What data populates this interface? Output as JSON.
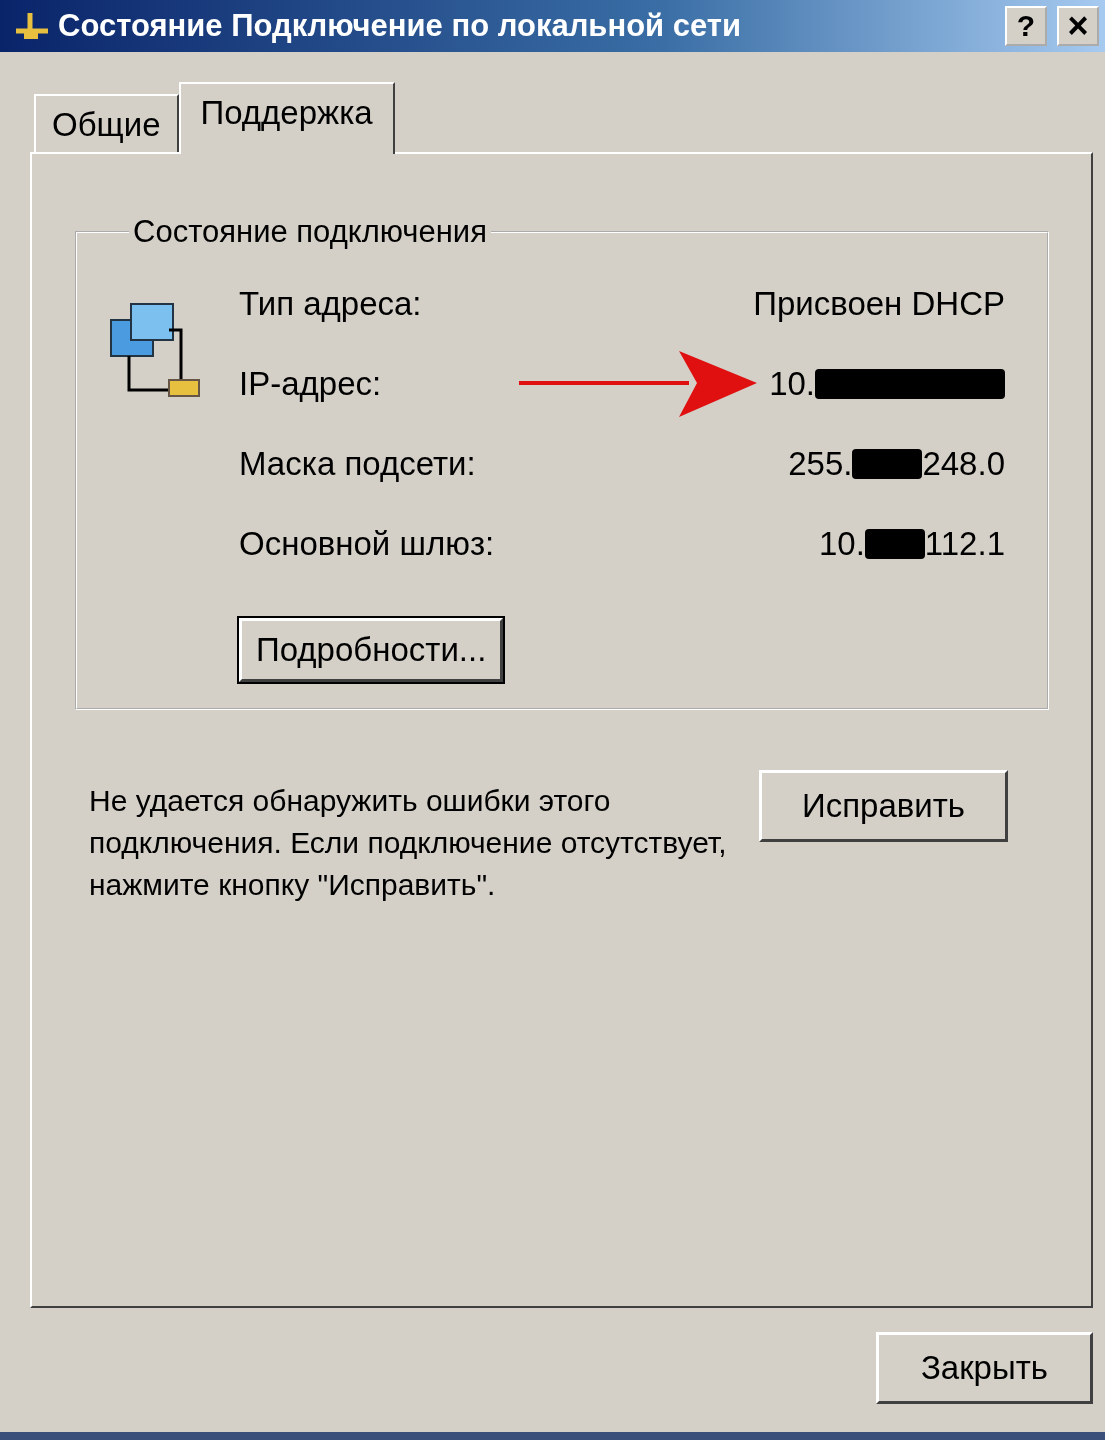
{
  "window": {
    "title": "Состояние Подключение по локальной сети",
    "buttons": [
      {
        "kind": "help",
        "label": "?"
      },
      {
        "kind": "close",
        "label": "×"
      }
    ]
  },
  "tabs": [
    {
      "label": "Общие",
      "selected": false
    },
    {
      "label": "Поддержка",
      "selected": true
    }
  ],
  "group": {
    "title": "Состояние подключения",
    "rows": [
      {
        "label": "Тип адреса:",
        "value_parts": [
          "Присвоен DHCP"
        ],
        "redacted": false,
        "pointed": false
      },
      {
        "label": "IP-адрес:",
        "value_parts": [
          "10."
        ],
        "redacted": true,
        "pointed": true
      },
      {
        "label": "Маска подсети:",
        "value_parts": [
          "255.",
          "248.0"
        ],
        "redacted": true,
        "pointed": false
      },
      {
        "label": "Основной шлюз:",
        "value_parts": [
          "10.",
          "112.1"
        ],
        "redacted": true,
        "pointed": false
      }
    ],
    "details_button": "Подробности..."
  },
  "message": "Не удается обнаружить ошибки этого подключения. Если подключение отсутствует, нажмите кнопку \"Исправить\".",
  "repair_button": "Исправить",
  "close_button": "Закрыть"
}
